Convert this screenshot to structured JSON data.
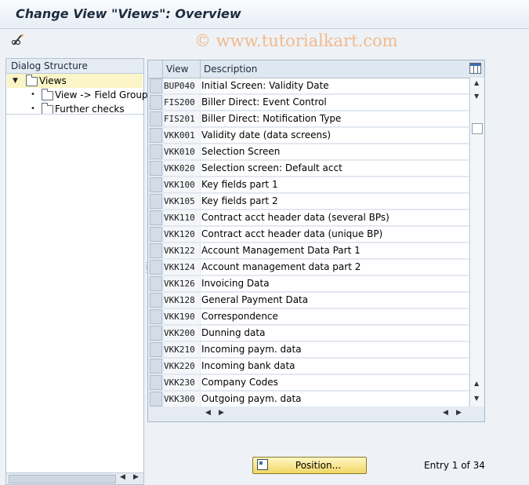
{
  "window": {
    "title": "Change View \"Views\": Overview"
  },
  "toolbar": {
    "edit_icon": "pencil-glasses-icon"
  },
  "watermark": "© www.tutorialkart.com",
  "dialog_structure": {
    "header": "Dialog Structure",
    "items": [
      {
        "label": "Views",
        "level": 0,
        "expanded": true,
        "selected": true
      },
      {
        "label": "View -> Field Groups",
        "level": 1
      },
      {
        "label": "Further checks",
        "level": 1
      }
    ]
  },
  "table": {
    "columns": [
      "View",
      "Description"
    ],
    "rows": [
      {
        "view": "BUP040",
        "description": "Initial Screen: Validity Date"
      },
      {
        "view": "FIS200",
        "description": "Biller Direct: Event Control"
      },
      {
        "view": "FIS201",
        "description": "Biller Direct: Notification Type"
      },
      {
        "view": "VKK001",
        "description": "Validity date (data screens)"
      },
      {
        "view": "VKK010",
        "description": "Selection Screen"
      },
      {
        "view": "VKK020",
        "description": "Selection screen: Default acct"
      },
      {
        "view": "VKK100",
        "description": "Key fields part 1"
      },
      {
        "view": "VKK105",
        "description": "Key fields part 2"
      },
      {
        "view": "VKK110",
        "description": "Contract acct header data (several BPs)"
      },
      {
        "view": "VKK120",
        "description": "Contract acct header data (unique BP)"
      },
      {
        "view": "VKK122",
        "description": "Account Management Data Part 1"
      },
      {
        "view": "VKK124",
        "description": "Account management data part 2"
      },
      {
        "view": "VKK126",
        "description": "Invoicing Data"
      },
      {
        "view": "VKK128",
        "description": "General Payment Data"
      },
      {
        "view": "VKK190",
        "description": "Correspondence"
      },
      {
        "view": "VKK200",
        "description": "Dunning data"
      },
      {
        "view": "VKK210",
        "description": "Incoming paym. data"
      },
      {
        "view": "VKK220",
        "description": "Incoming bank data"
      },
      {
        "view": "VKK230",
        "description": "Company Codes"
      },
      {
        "view": "VKK300",
        "description": "Outgoing paym. data"
      }
    ]
  },
  "footer": {
    "position_button": "Position...",
    "entry_text": "Entry 1 of 34"
  },
  "colors": {
    "selected_tree_bg": "#fbf5c8",
    "button_yellow": "#f1d765",
    "watermark": "#f2b98c"
  }
}
